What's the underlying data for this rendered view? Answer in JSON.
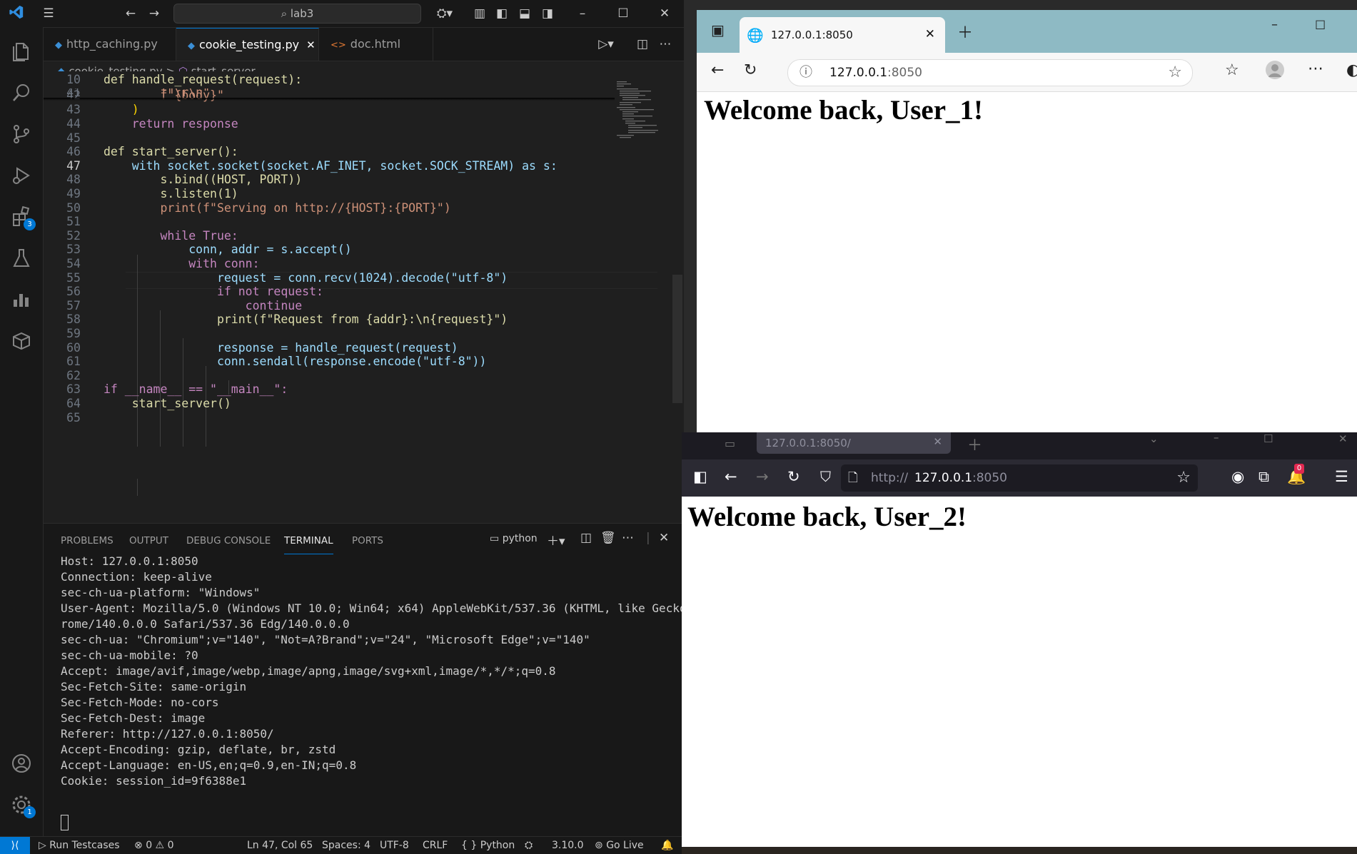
{
  "vscode": {
    "titlebar": {
      "search_text": "lab3"
    },
    "tabs": [
      {
        "label": "http_caching.py",
        "active": false
      },
      {
        "label": "cookie_testing.py",
        "active": true
      },
      {
        "label": "doc.html",
        "active": false
      }
    ],
    "breadcrumb": {
      "file": "cookie_testing.py",
      "separator": ">",
      "symbol": "start_server"
    },
    "activity_badges": {
      "extensions": "3",
      "settings": "1"
    },
    "code": {
      "sticky_line_number": "10",
      "sticky_line": "def handle_request(request):",
      "current_line": "47",
      "lines": [
        {
          "n": "41",
          "text": "        f\"\\r\\n\""
        },
        {
          "n": "42",
          "text": "        f\"{body}\""
        },
        {
          "n": "43",
          "text": "    )"
        },
        {
          "n": "44",
          "text": "    return response"
        },
        {
          "n": "45",
          "text": ""
        },
        {
          "n": "46",
          "text": "def start_server():"
        },
        {
          "n": "47",
          "text": "    with socket.socket(socket.AF_INET, socket.SOCK_STREAM) as s:"
        },
        {
          "n": "48",
          "text": "        s.bind((HOST, PORT))"
        },
        {
          "n": "49",
          "text": "        s.listen(1)"
        },
        {
          "n": "50",
          "text": "        print(f\"Serving on http://{HOST}:{PORT}\")"
        },
        {
          "n": "51",
          "text": ""
        },
        {
          "n": "52",
          "text": "        while True:"
        },
        {
          "n": "53",
          "text": "            conn, addr = s.accept()"
        },
        {
          "n": "54",
          "text": "            with conn:"
        },
        {
          "n": "55",
          "text": "                request = conn.recv(1024).decode(\"utf-8\")"
        },
        {
          "n": "56",
          "text": "                if not request:"
        },
        {
          "n": "57",
          "text": "                    continue"
        },
        {
          "n": "58",
          "text": "                print(f\"Request from {addr}:\\n{request}\")"
        },
        {
          "n": "59",
          "text": ""
        },
        {
          "n": "60",
          "text": "                response = handle_request(request)"
        },
        {
          "n": "61",
          "text": "                conn.sendall(response.encode(\"utf-8\"))"
        },
        {
          "n": "62",
          "text": ""
        },
        {
          "n": "63",
          "text": "if __name__ == \"__main__\":"
        },
        {
          "n": "64",
          "text": "    start_server()"
        },
        {
          "n": "65",
          "text": ""
        }
      ]
    },
    "panel": {
      "tabs": [
        "PROBLEMS",
        "OUTPUT",
        "DEBUG CONSOLE",
        "TERMINAL",
        "PORTS"
      ],
      "active_tab": "TERMINAL",
      "terminal_name": "python",
      "terminal_lines": [
        "Host: 127.0.0.1:8050",
        "Connection: keep-alive",
        "sec-ch-ua-platform: \"Windows\"",
        "User-Agent: Mozilla/5.0 (Windows NT 10.0; Win64; x64) AppleWebKit/537.36 (KHTML, like Gecko) Ch",
        "rome/140.0.0.0 Safari/537.36 Edg/140.0.0.0",
        "sec-ch-ua: \"Chromium\";v=\"140\", \"Not=A?Brand\";v=\"24\", \"Microsoft Edge\";v=\"140\"",
        "sec-ch-ua-mobile: ?0",
        "Accept: image/avif,image/webp,image/apng,image/svg+xml,image/*,*/*;q=0.8",
        "Sec-Fetch-Site: same-origin",
        "Sec-Fetch-Mode: no-cors",
        "Sec-Fetch-Dest: image",
        "Referer: http://127.0.0.1:8050/",
        "Accept-Encoding: gzip, deflate, br, zstd",
        "Accept-Language: en-US,en;q=0.9,en-IN;q=0.8",
        "Cookie: session_id=9f6388e1"
      ]
    },
    "statusbar": {
      "run_testcases": "Run Testcases",
      "errors": "0",
      "warnings": "0",
      "position": "Ln 47, Col 65",
      "spaces": "Spaces: 4",
      "encoding": "UTF-8",
      "eol": "CRLF",
      "language": "Python",
      "python_version": "3.10.0",
      "go_live": "Go Live"
    }
  },
  "edge": {
    "tab_title": "127.0.0.1:8050",
    "address_host": "127.0.0.1",
    "address_port": ":8050",
    "heading": "Welcome back, User_1!"
  },
  "firefox": {
    "tab_title": "127.0.0.1:8050/",
    "address_prefix": "http://",
    "address_host": "127.0.0.1",
    "address_port": ":8050",
    "notification_badge": "0",
    "heading": "Welcome back, User_2!"
  },
  "colors": {
    "vscode_accent": "#0078d4",
    "edge_tabbar": "#8ebac4",
    "firefox_toolbar": "#2b2a33"
  }
}
